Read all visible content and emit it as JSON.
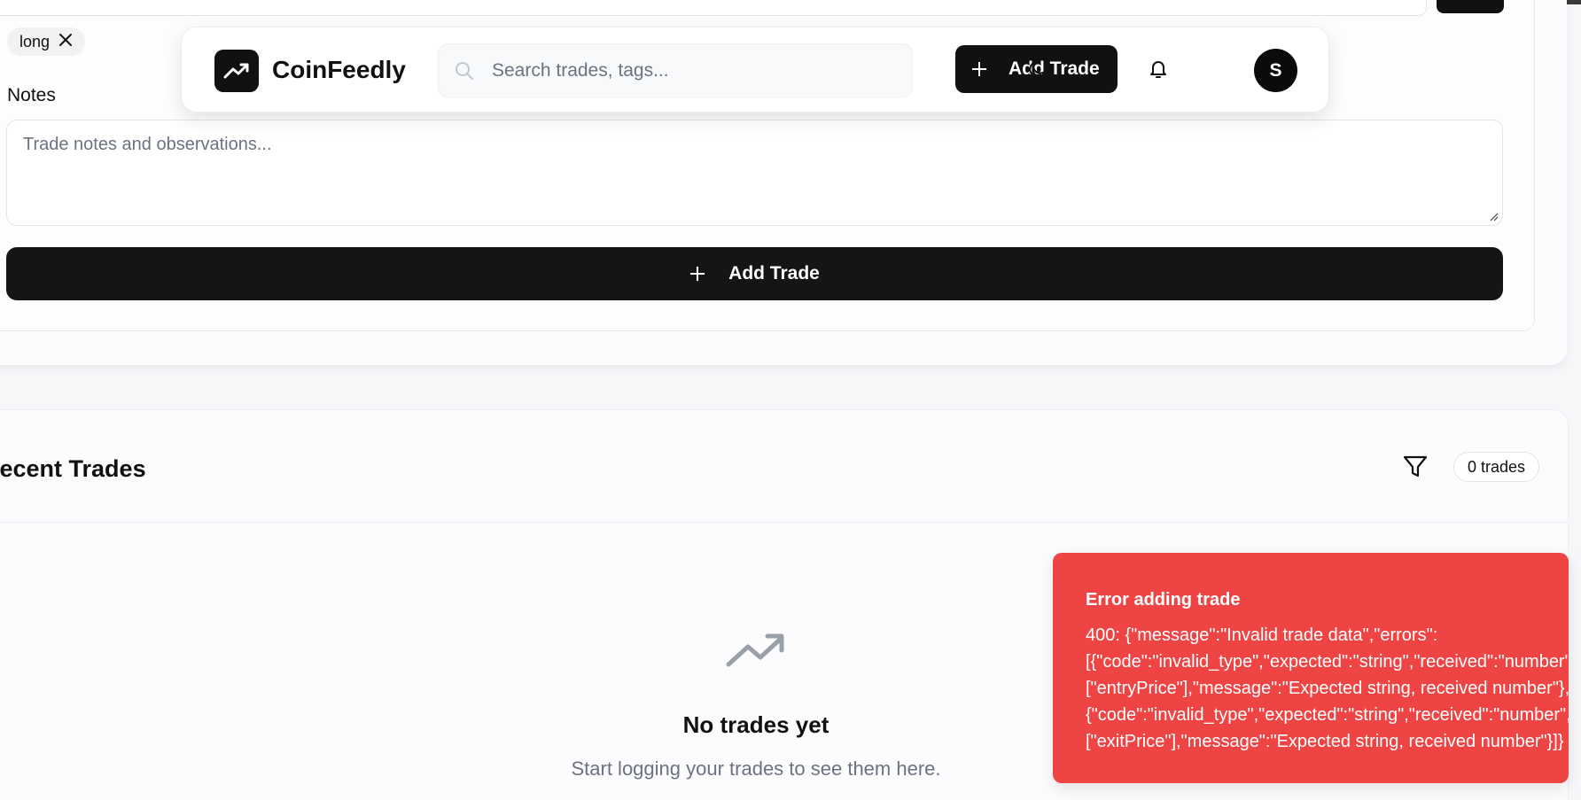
{
  "form": {
    "tags": [
      {
        "label": "long"
      }
    ],
    "notes_label": "Notes",
    "notes_placeholder": "Trade notes and observations...",
    "submit_label": "Add Trade"
  },
  "header": {
    "brand": "CoinFeedly",
    "search_placeholder": "Search trades, tags...",
    "add_trade_label": "Add Trade",
    "avatar_initial": "S"
  },
  "trades": {
    "title": "Recent Trades",
    "count_label": "0 trades",
    "empty_title": "No trades yet",
    "empty_subtitle": "Start logging your trades to see them here."
  },
  "toast": {
    "title": "Error adding trade",
    "lines": [
      "400: {\"message\":\"Invalid trade data\",\"errors\":",
      "[{\"code\":\"invalid_type\",\"expected\":\"string\",\"received\":\"number\",\"path\":",
      "[\"entryPrice\"],\"message\":\"Expected string, received number\"},",
      "{\"code\":\"invalid_type\",\"expected\":\"string\",\"received\":\"number\",\"path\":",
      "[\"exitPrice\"],\"message\":\"Expected string, received number\"}]}"
    ]
  },
  "colors": {
    "primary": "#111111",
    "error": "#ef4444",
    "muted_text": "#6b7280",
    "page_bg": "#f7f7fa"
  },
  "icons": {
    "logo": "trending-up-icon",
    "search": "search-icon",
    "theme": "moon-icon",
    "notifications": "bell-icon",
    "filter": "filter-icon",
    "empty_state": "trending-up-icon",
    "remove_tag": "close-icon",
    "add": "plus-icon"
  }
}
